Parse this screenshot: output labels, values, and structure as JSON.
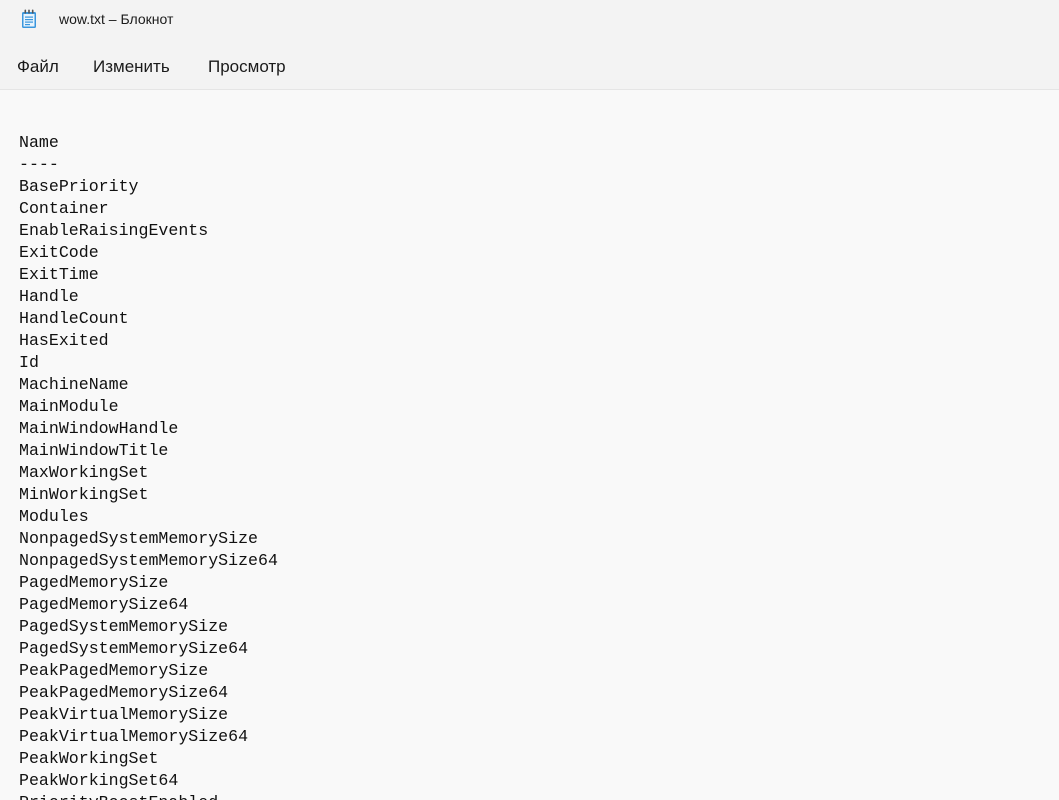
{
  "window": {
    "title": "wow.txt – Блокнот",
    "icon": "notepad-icon"
  },
  "menu": {
    "items": [
      {
        "label": "Файл"
      },
      {
        "label": "Изменить"
      },
      {
        "label": "Просмотр"
      }
    ]
  },
  "editor": {
    "lines": [
      "Name",
      "----",
      "BasePriority",
      "Container",
      "EnableRaisingEvents",
      "ExitCode",
      "ExitTime",
      "Handle",
      "HandleCount",
      "HasExited",
      "Id",
      "MachineName",
      "MainModule",
      "MainWindowHandle",
      "MainWindowTitle",
      "MaxWorkingSet",
      "MinWorkingSet",
      "Modules",
      "NonpagedSystemMemorySize",
      "NonpagedSystemMemorySize64",
      "PagedMemorySize",
      "PagedMemorySize64",
      "PagedSystemMemorySize",
      "PagedSystemMemorySize64",
      "PeakPagedMemorySize",
      "PeakPagedMemorySize64",
      "PeakVirtualMemorySize",
      "PeakVirtualMemorySize64",
      "PeakWorkingSet",
      "PeakWorkingSet64",
      "PriorityBoostEnabled"
    ]
  }
}
